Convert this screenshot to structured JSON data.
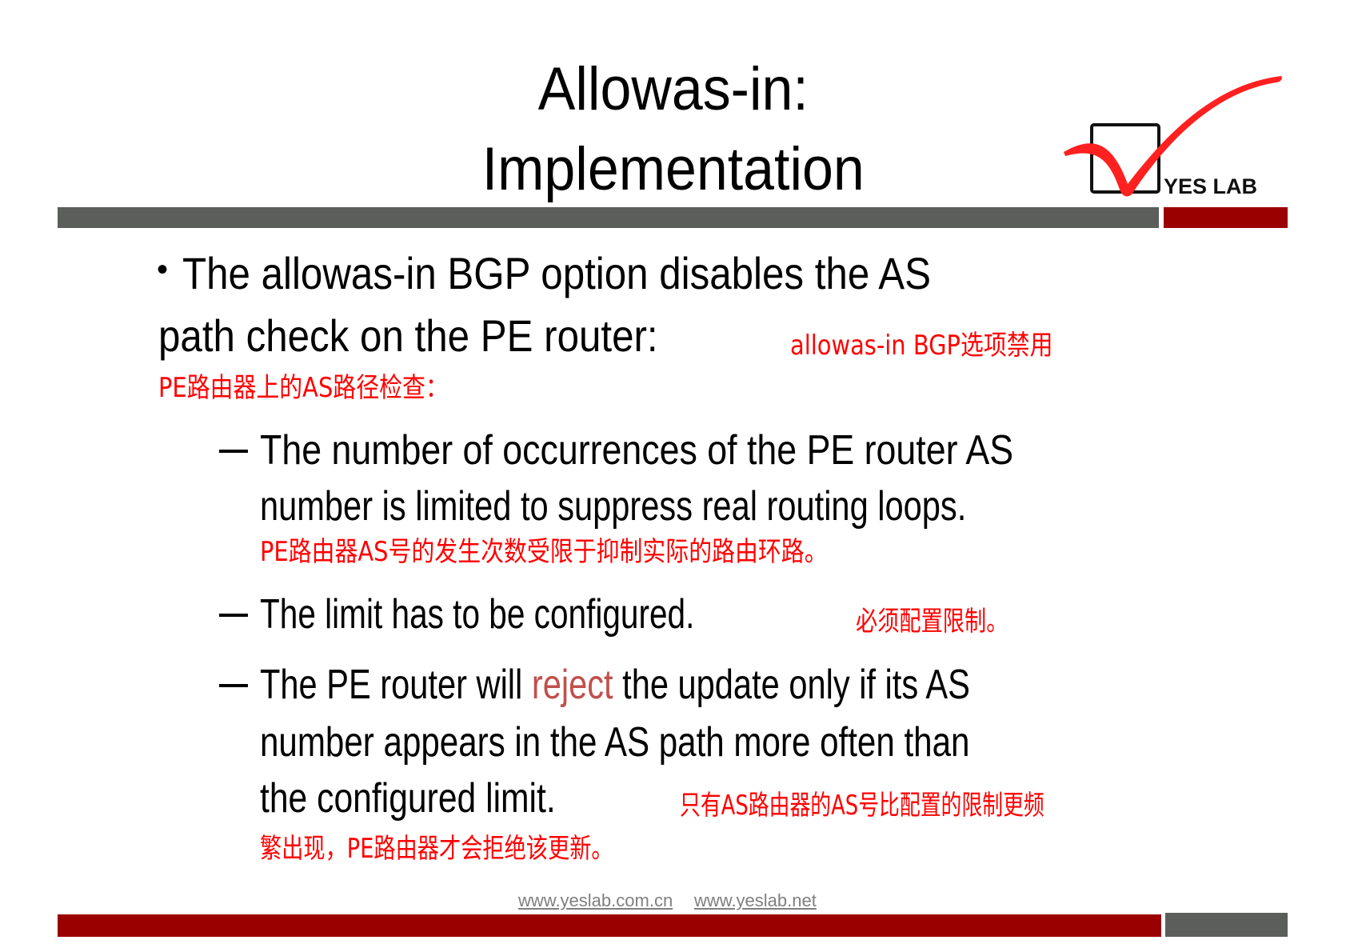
{
  "slide": {
    "title_line1": "Allowas-in:",
    "title_line2": "Implementation",
    "logo": {
      "text": "YES LAB",
      "icon": "checkmark-box-icon",
      "accent": "#ff2020"
    },
    "bullet": {
      "line1": "The allowas-in BGP option disables the AS",
      "line2": "path check on the PE router:",
      "line2_cn": "allowas-in BGP选项禁用",
      "cn_line": "PE路由器上的AS路径检查："
    },
    "sub_bullets": [
      {
        "line1": "The number of occurrences of the PE router AS",
        "line2": "number is limited to suppress real routing loops.",
        "cn": "PE路由器AS号的发生次数受限于抑制实际的路由环路。"
      },
      {
        "line1": "The limit has to be configured.",
        "cn_inline": "必须配置限制。"
      },
      {
        "line1_pre": "The PE router will ",
        "line1_highlight": "reject",
        "line1_post": " the update only if its AS",
        "line2": "number appears in the AS path more often than",
        "line3": "the  configured  limit.",
        "line3_cn": "只有AS路由器的AS号比配置的限制更频",
        "cn_line": "繁出现，PE路由器才会拒绝该更新。"
      }
    ],
    "footer": {
      "link1": "www.yeslab.com.cn",
      "link2": "www.yeslab.net"
    },
    "colors": {
      "bar_grey": "#5c5e5b",
      "bar_red": "#9b0000",
      "translation_red": "#ff0000",
      "highlight": "#c0504d"
    }
  }
}
